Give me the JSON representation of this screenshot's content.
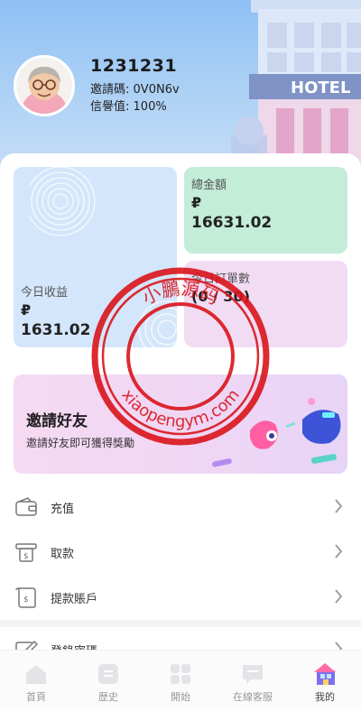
{
  "profile": {
    "user_id": "1231231",
    "invite_label": "邀請碼:",
    "invite_code": "0V0N6v",
    "credit_label": "信譽值:",
    "credit_value": "100%",
    "hotel_sign": "HOTEL"
  },
  "stats": {
    "today_income_label": "今日收益",
    "today_income_currency": "₽",
    "today_income_value": "1631.02",
    "total_label": "總金額",
    "total_currency": "₽",
    "total_value": "16631.02",
    "orders_label": "今日訂單數",
    "orders_value": "(0 / 30)"
  },
  "invite": {
    "title": "邀請好友",
    "subtitle": "邀請好友即可獲得獎勵"
  },
  "menu": [
    {
      "label": "充值",
      "icon": "wallet-icon"
    },
    {
      "label": "取款",
      "icon": "atm-withdraw-icon"
    },
    {
      "label": "提款賬戶",
      "icon": "receipt-icon"
    },
    {
      "label": "登錄密碼",
      "icon": "edit-icon"
    }
  ],
  "watermark": {
    "top_text": "小鵬源码",
    "bottom_text": "xiaopengym.com",
    "color": "#d9141b"
  },
  "nav": [
    {
      "label": "首頁",
      "icon": "home-icon"
    },
    {
      "label": "歷史",
      "icon": "history-icon"
    },
    {
      "label": "開始",
      "icon": "start-grid-icon"
    },
    {
      "label": "在線客服",
      "icon": "chat-support-icon"
    },
    {
      "label": "我的",
      "icon": "profile-house-icon",
      "active": true
    }
  ],
  "colors": {
    "header_bg": "#9cc7f5",
    "card_blue": "#d4e6fb",
    "card_green": "#c3ecd9",
    "card_pink": "#f1dcf3",
    "banner_pink": "#f3d8f3"
  }
}
